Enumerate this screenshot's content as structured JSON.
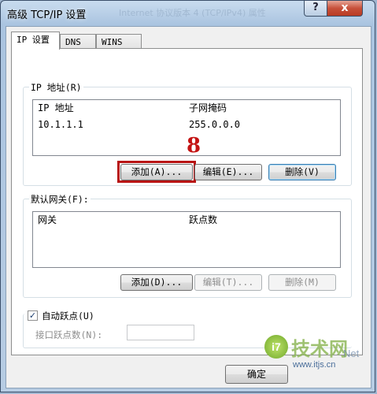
{
  "window": {
    "title": "高级 TCP/IP 设置",
    "title_ghost": "Internet 协议版本 4 (TCP/IPv4) 属性",
    "help_glyph": "?",
    "close_glyph": "x"
  },
  "tabs": [
    {
      "label": "IP 设置",
      "active": true
    },
    {
      "label": "DNS",
      "active": false
    },
    {
      "label": "WINS",
      "active": false
    }
  ],
  "ip_group": {
    "title": "IP 地址(R)",
    "col_ip": "IP 地址",
    "col_mask": "子网掩码",
    "rows": [
      {
        "ip": "10.1.1.1",
        "mask": "255.0.0.0"
      }
    ],
    "add_label": "添加(A)...",
    "edit_label": "编辑(E)...",
    "delete_label": "删除(V)"
  },
  "annotation": {
    "step_number": "8",
    "color": "#c41414"
  },
  "gateway_group": {
    "title": "默认网关(F):",
    "col_gateway": "网关",
    "col_metric": "跃点数",
    "add_label": "添加(D)...",
    "edit_label": "编辑(T)...",
    "delete_label": "删除(M)"
  },
  "auto_metric": {
    "checkbox_label": "自动跃点(U)",
    "checked": true,
    "check_glyph": "✓",
    "interface_metric_label": "接口跃点数(N):",
    "interface_metric_value": ""
  },
  "footer": {
    "ok_label": "确定"
  },
  "watermark": {
    "logo_char": "i7",
    "brand": "技术网",
    "url": "www.itjs.cn",
    "suffix": "Net"
  }
}
